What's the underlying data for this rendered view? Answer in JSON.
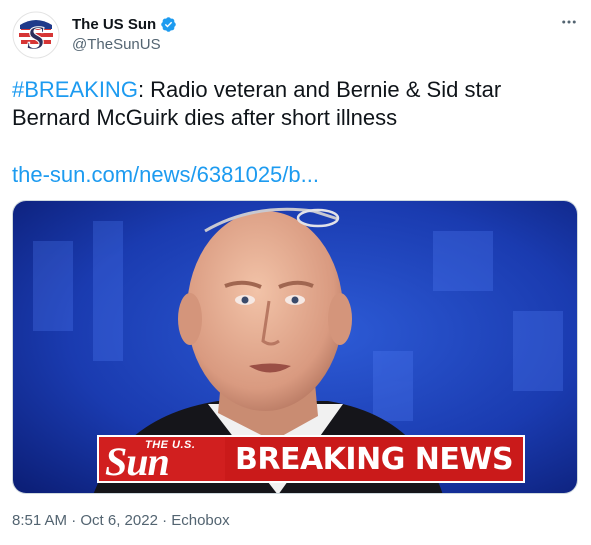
{
  "account": {
    "name": "The US Sun",
    "handle": "@TheSunUS",
    "verified": true,
    "avatar_icon": "the-us-sun-logo-icon"
  },
  "tweet": {
    "hashtag": "#BREAKING",
    "text_rest": ": Radio veteran and Bernie & Sid star Bernard McGuirk dies after short illness",
    "link": "the-sun.com/news/6381025/b..."
  },
  "media": {
    "banner_brand_small": "THE U.S.",
    "banner_brand": "Sun",
    "banner_text": "BREAKING NEWS"
  },
  "meta": {
    "timestamp": "8:51 AM · Oct 6, 2022 · Echobox"
  },
  "colors": {
    "accent": "#1d9bf0",
    "brand_red": "#d11f1f",
    "muted": "#536471"
  }
}
